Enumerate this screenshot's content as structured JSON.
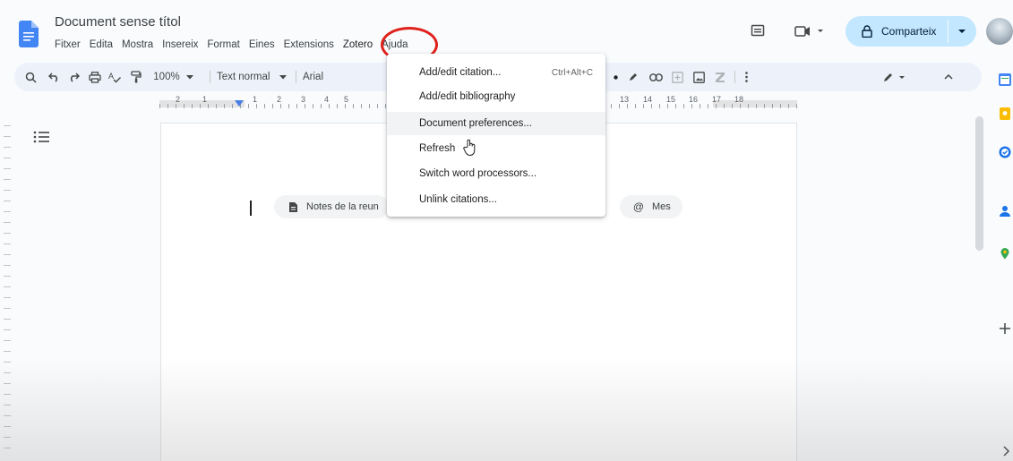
{
  "document": {
    "title": "Document sense títol"
  },
  "menu": [
    "Fitxer",
    "Edita",
    "Mostra",
    "Insereix",
    "Format",
    "Eines",
    "Extensions",
    "Zotero",
    "Ajuda"
  ],
  "header": {
    "share_label": "Comparteix"
  },
  "toolbar": {
    "zoom": "100%",
    "style": "Text normal",
    "font": "Arial"
  },
  "ruler": {
    "left_numbers": [
      "2",
      "1",
      "1",
      "2",
      "3",
      "4",
      "5"
    ],
    "right_numbers": [
      "13",
      "14",
      "15",
      "16",
      "17",
      "18"
    ]
  },
  "chips": [
    {
      "label": "Notes de la reun"
    },
    {
      "label": "Mes"
    }
  ],
  "zotero_menu": {
    "items": [
      {
        "label": "Add/edit citation...",
        "shortcut": "Ctrl+Alt+C"
      },
      {
        "label": "Add/edit bibliography",
        "shortcut": ""
      },
      {
        "label": "Document preferences...",
        "shortcut": ""
      },
      {
        "label": "Refresh",
        "shortcut": ""
      },
      {
        "label": "Switch word processors...",
        "shortcut": ""
      },
      {
        "label": "Unlink citations...",
        "shortcut": ""
      }
    ]
  },
  "colors": {
    "accent": "#c2e7ff",
    "highlight": "#e0201b",
    "doc_blue": "#4285f4"
  }
}
